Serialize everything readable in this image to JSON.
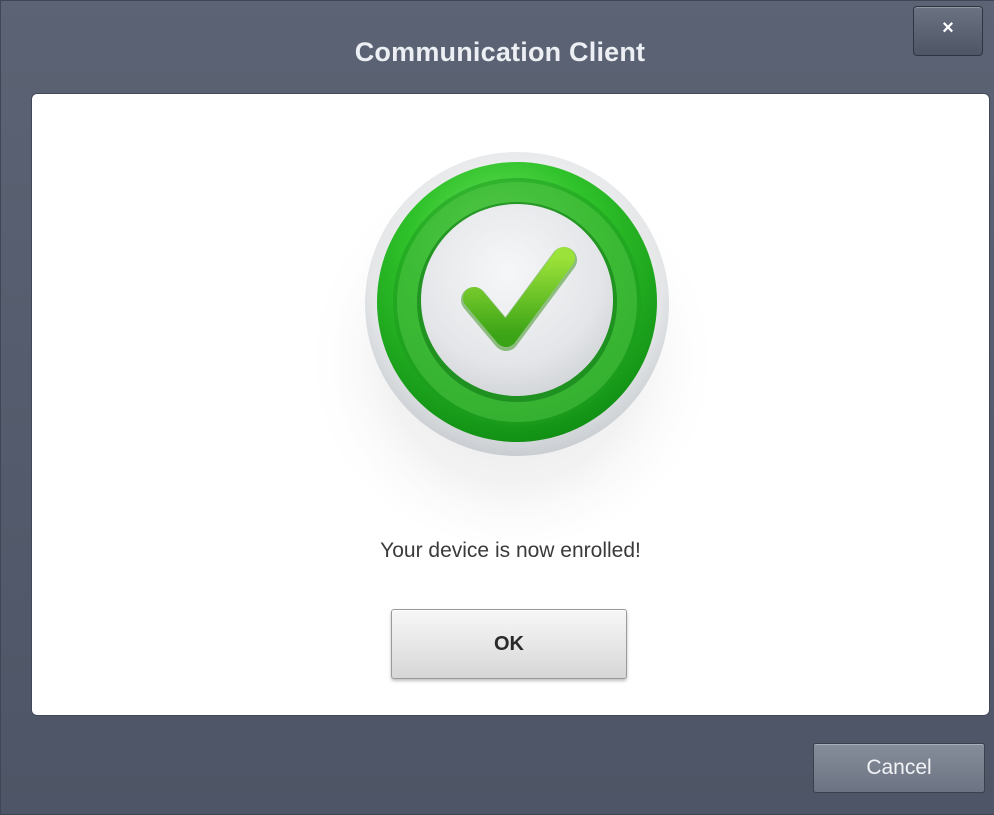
{
  "window": {
    "title": "Communication Client",
    "close_label": "×"
  },
  "content": {
    "status_icon": "success-checkmark-icon",
    "message": "Your device is now enrolled!",
    "ok_label": "OK"
  },
  "footer": {
    "cancel_label": "Cancel"
  },
  "colors": {
    "accent_green": "#2fb82a",
    "check_green": "#6cc81e",
    "window_bg": "#555d6e"
  }
}
